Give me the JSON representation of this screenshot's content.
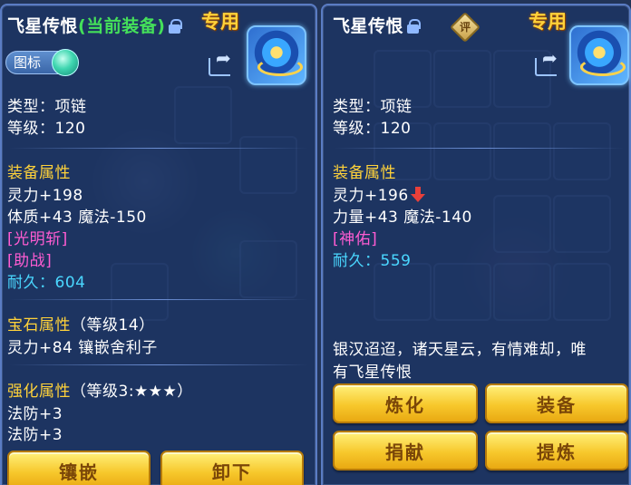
{
  "left_panel": {
    "item_name": "飞星传恨",
    "equipped_tag": "(当前装备)",
    "exclusive_label": "专用",
    "tag_button_label": "图标",
    "type_line": "类型：项链",
    "level_line": "等级：120",
    "equip_attr_header": "装备属性",
    "attr_lines": [
      "灵力+198",
      "体质+43 魔法-150"
    ],
    "skill_1": "[光明斩]",
    "skill_2": "[助战]",
    "durability_label": "耐久：",
    "durability_value": "604",
    "gem_header": "宝石属性",
    "gem_level": "（等级14）",
    "gem_line": "灵力+84 镶嵌舍利子",
    "enhance_header": "强化属性",
    "enhance_level": "（等级3:★★★）",
    "enhance_lines": [
      "法防+3",
      "法防+3"
    ],
    "buttons": {
      "inlay": "镶嵌",
      "unequip": "卸下"
    }
  },
  "right_panel": {
    "item_name": "飞星传恨",
    "review_label": "评",
    "exclusive_label": "专用",
    "type_line": "类型：项链",
    "level_line": "等级：120",
    "equip_attr_header": "装备属性",
    "attr_line_1": "灵力+196",
    "attr_line_2": "力量+43 魔法-140",
    "skill_1": "[神佑]",
    "durability_label": "耐久：",
    "durability_value": "559",
    "description": [
      "银汉迢迢，诸天星云，有情难却，唯",
      "有飞星传恨"
    ],
    "buttons": {
      "refine": "炼化",
      "equip": "装备",
      "donate": "捐献",
      "extract": "提炼"
    }
  },
  "colors": {
    "section": "#ffd23a",
    "equipped": "#44e05a",
    "skill": "#ff5cd2",
    "durability": "#4ad7ff",
    "button": "#f7c82c"
  }
}
